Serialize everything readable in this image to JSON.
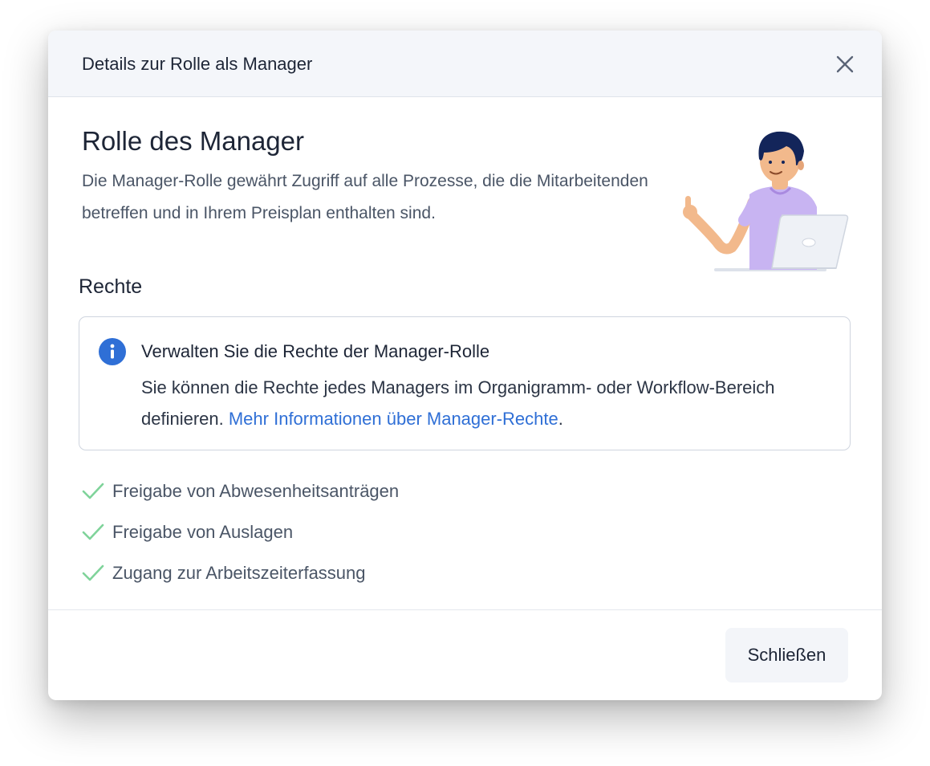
{
  "modal": {
    "title": "Details zur Rolle als Manager",
    "close_icon": "close-icon"
  },
  "role": {
    "heading": "Rolle des Manager",
    "description": "Die Manager-Rolle gewährt Zugriff auf alle Prozesse, die die Mitarbeitenden betreffen und in Ihrem Preisplan enthalten sind.",
    "illustration": "manager-with-laptop-illustration"
  },
  "rights": {
    "heading": "Rechte",
    "info": {
      "icon": "info-icon",
      "title": "Verwalten Sie die Rechte der Manager-Rolle",
      "text": "Sie können die Rechte jedes Managers im Organigramm- oder Workflow-Bereich definieren. ",
      "link": "Mehr Informationen über Manager-Rechte",
      "suffix": "."
    },
    "items": [
      {
        "label": "Freigabe von Abwesenheitsanträgen",
        "icon": "check-icon"
      },
      {
        "label": "Freigabe von Auslagen",
        "icon": "check-icon"
      },
      {
        "label": "Zugang zur Arbeitszeiterfassung",
        "icon": "check-icon"
      }
    ]
  },
  "footer": {
    "close_label": "Schließen"
  },
  "colors": {
    "link": "#2f6fd6",
    "info_icon": "#2f6fd6",
    "check": "#7fd39a",
    "header_bg": "#f4f6fa"
  }
}
